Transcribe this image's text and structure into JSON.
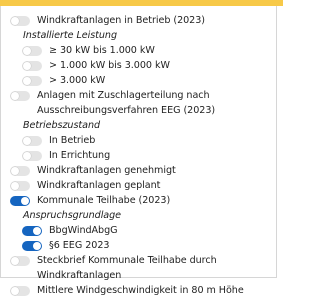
{
  "colors": {
    "accent_toggle_on": "#1565c0",
    "toggle_off": "#e4e4e4",
    "top_strip": "#f7c948"
  },
  "layers": {
    "windkraft_betrieb": {
      "label": "Windkraftanlagen in Betrieb (2023)",
      "on": false
    },
    "installierte_leistung": {
      "label": "Installierte Leistung"
    },
    "leistung_30_1000": {
      "label": "≥ 30 kW bis 1.000 kW",
      "on": false
    },
    "leistung_1000_3000": {
      "label": "> 1.000 kW bis 3.000 kW",
      "on": false
    },
    "leistung_3000": {
      "label": "> 3.000 kW",
      "on": false
    },
    "zuschlag": {
      "label": "Anlagen mit Zuschlagerteilung nach Ausschreibungsverfahren EEG (2023)",
      "on": false
    },
    "betriebszustand": {
      "label": "Betriebszustand"
    },
    "in_betrieb": {
      "label": "In Betrieb",
      "on": false
    },
    "in_errichtung": {
      "label": "In Errichtung",
      "on": false
    },
    "genehmigt": {
      "label": "Windkraftanlagen genehmigt",
      "on": false
    },
    "geplant": {
      "label": "Windkraftanlagen geplant",
      "on": false
    },
    "kommunale_teilhabe": {
      "label": "Kommunale Teilhabe (2023)",
      "on": true
    },
    "anspruchsgrundlage": {
      "label": "Anspruchsgrundlage"
    },
    "bbgwindabgg": {
      "label": "BbgWindAbgG",
      "on": true
    },
    "eeg_6": {
      "label": "§6 EEG 2023",
      "on": true
    },
    "steckbrief": {
      "label": "Steckbrief Kommunale Teilhabe durch Windkraftanlagen",
      "on": false
    },
    "windgeschwindigkeit": {
      "label": "Mittlere Windgeschwindigkeit in 80 m Höhe",
      "on": false
    }
  }
}
